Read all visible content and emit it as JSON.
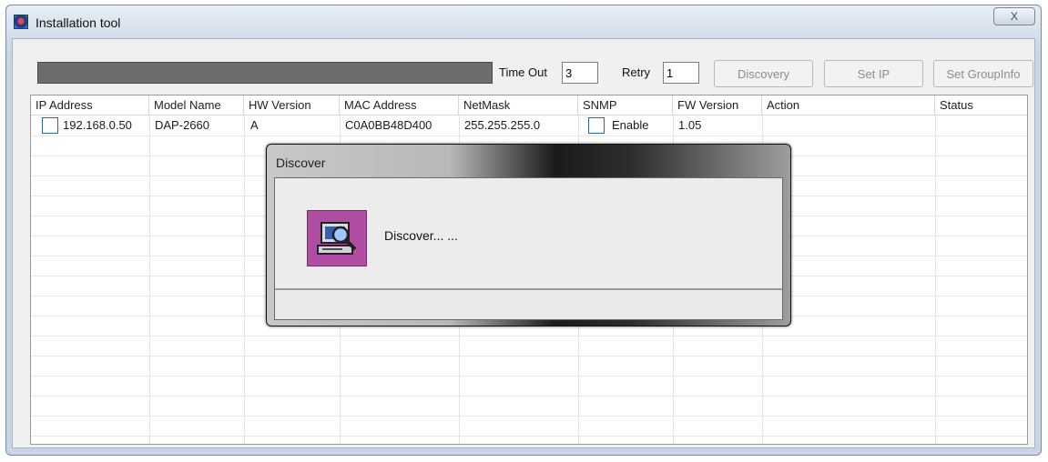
{
  "window": {
    "title": "Installation tool",
    "close_glyph": "X",
    "icons": {
      "app": "app-logo-icon",
      "close": "close-icon"
    }
  },
  "toolbar": {
    "progress_percent": 100,
    "timeout_label": "Time Out",
    "timeout_value": "3",
    "retry_label": "Retry",
    "retry_value": "1",
    "discovery_label": "Discovery",
    "setip_label": "Set IP",
    "setgroup_label": "Set GroupInfo"
  },
  "table": {
    "columns": [
      "IP Address",
      "Model Name",
      "HW Version",
      "MAC Address",
      "NetMask",
      "SNMP",
      "FW Version",
      "Action",
      "Status"
    ],
    "rows": [
      {
        "ip": "192.168.0.50",
        "model": "DAP-2660",
        "hw": "A",
        "mac": "C0A0BB48D400",
        "netmask": "255.255.255.0",
        "snmp": "Enable",
        "fw": "1.05",
        "action": "",
        "status": ""
      }
    ]
  },
  "dialog": {
    "title": "Discover",
    "message": "Discover... ...",
    "icon": "computer-search-icon"
  },
  "colors": {
    "progress_fill": "#6d6d6d",
    "dialog_icon_bg": "#b14ea3",
    "checkbox_border": "#2d67a8"
  }
}
